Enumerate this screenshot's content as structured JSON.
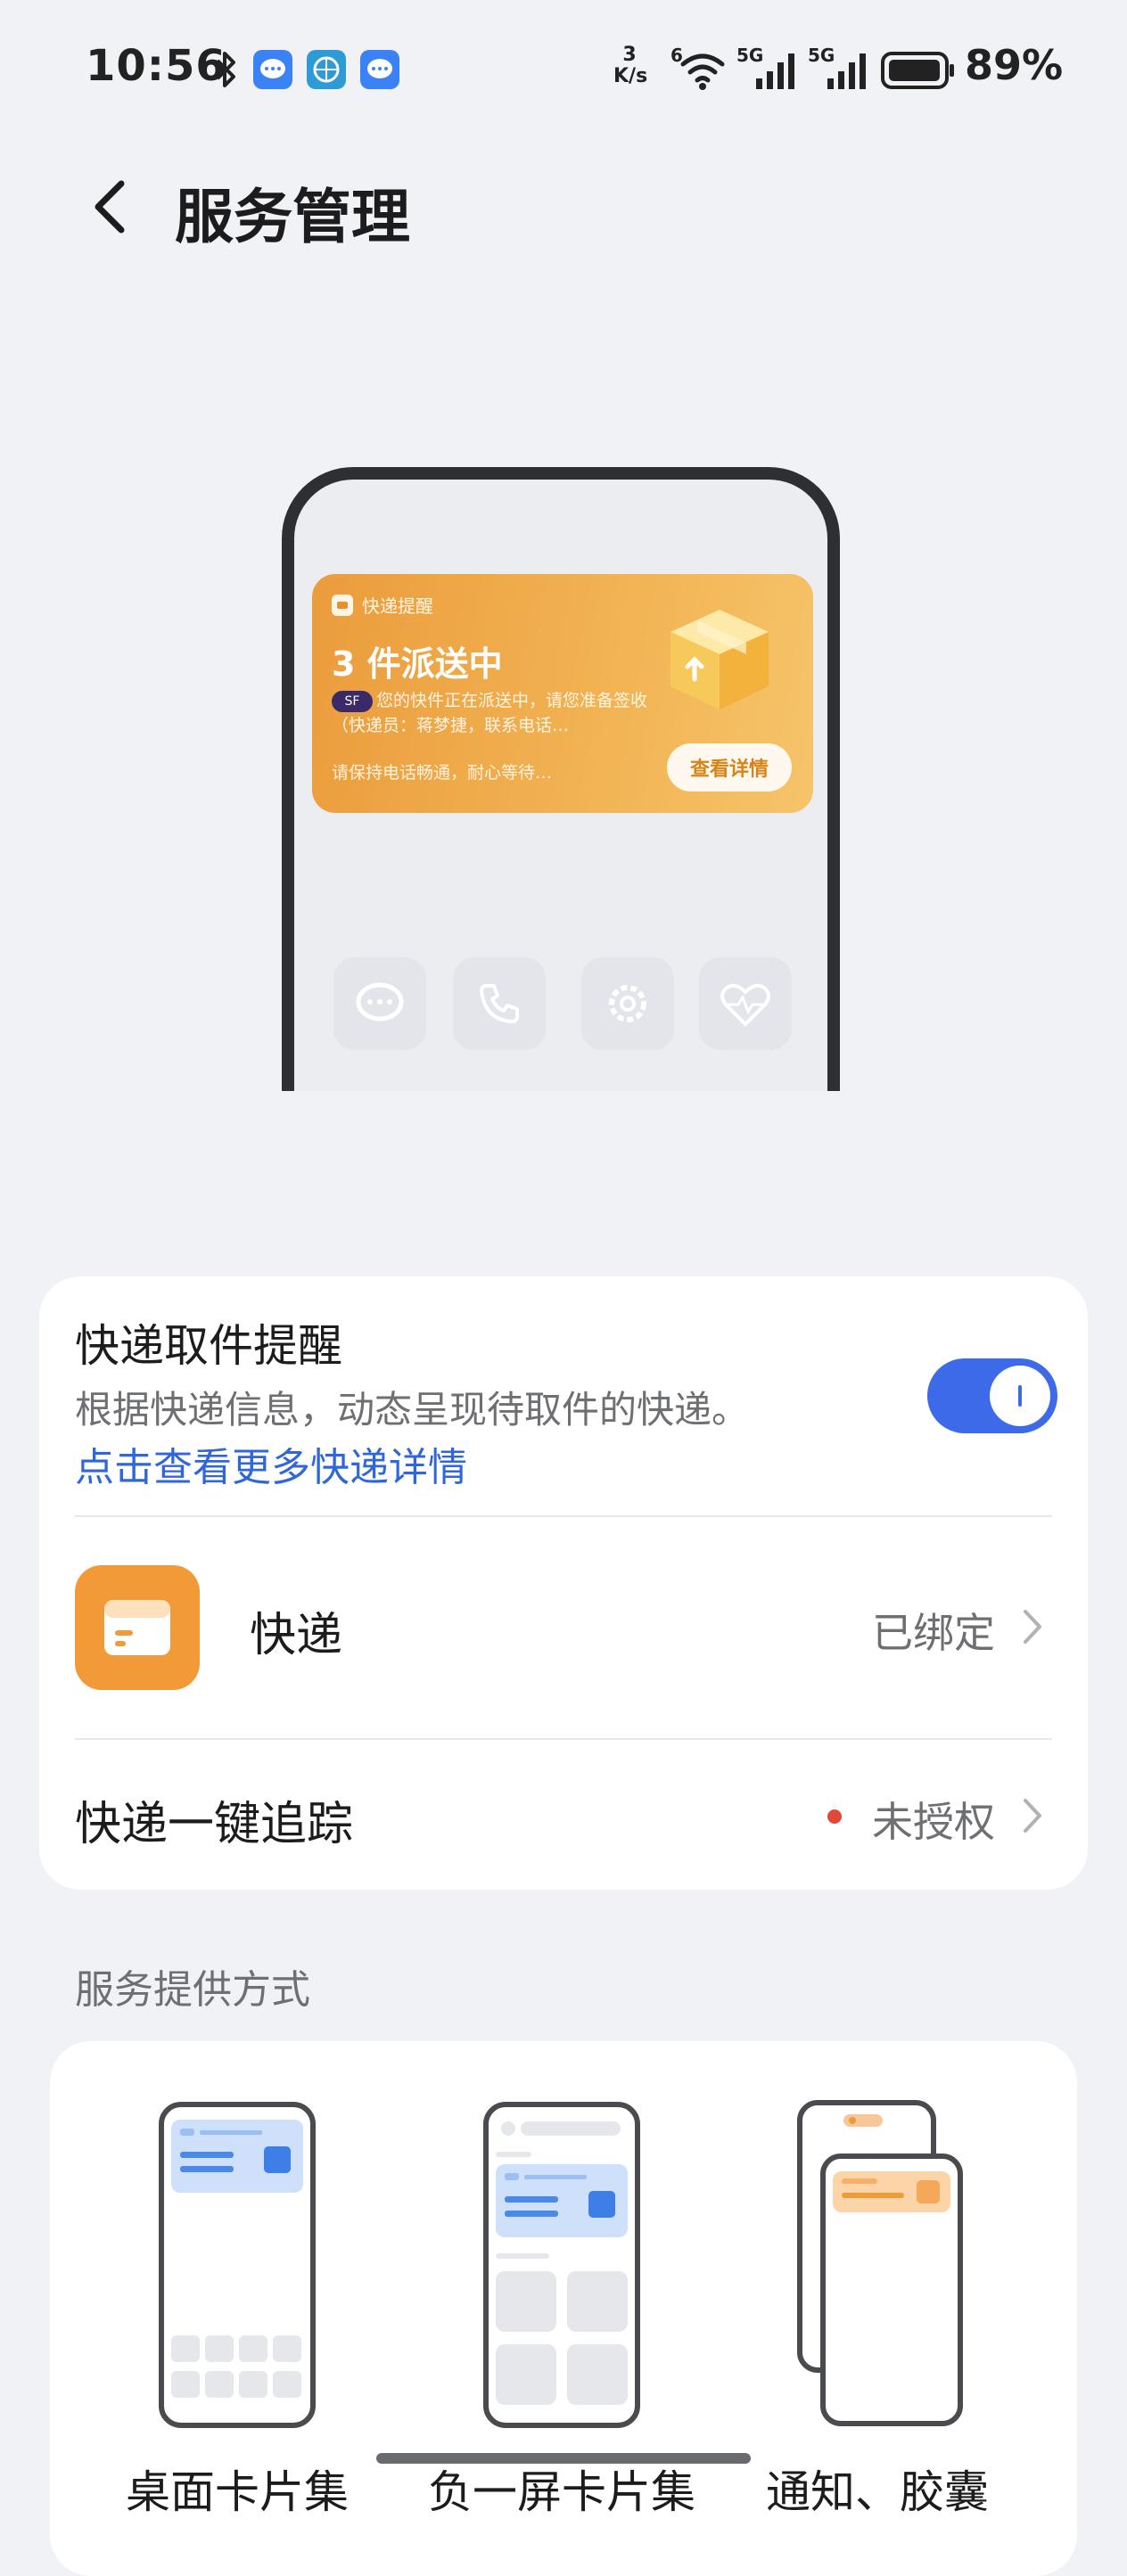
{
  "status_bar": {
    "time": "10:56",
    "net_speed_value": "3",
    "net_speed_unit": "K/s",
    "wifi_label": "6",
    "signal1_label": "5G",
    "signal2_label": "5G",
    "battery": "89%",
    "battery_level": 0.89
  },
  "header": {
    "title": "服务管理"
  },
  "illustration": {
    "card_header": "快递提醒",
    "count_text": "3 件派送中",
    "description": "您的快件正在派送中，请您准备签收（快递员：蒋梦捷，联系电话…",
    "hint": "请保持电话畅通，耐心等待…",
    "button": "查看详情",
    "brand": "SF"
  },
  "reminder": {
    "title": "快递取件提醒",
    "description": "根据快递信息，动态呈现待取件的快递。",
    "link": "点击查看更多快递详情",
    "enabled": true
  },
  "rows": [
    {
      "label": "快递",
      "value": "已绑定"
    },
    {
      "label": "快递一键追踪",
      "value": "未授权"
    }
  ],
  "section_title": "服务提供方式",
  "modes": [
    {
      "label": "桌面卡片集"
    },
    {
      "label": "负一屏卡片集"
    },
    {
      "label": "通知、胶囊"
    }
  ],
  "colors": {
    "accent": "#3d6ae8",
    "link": "#2f66d9",
    "express_orange": "#f29a38",
    "alert_red": "#e04a3a"
  }
}
